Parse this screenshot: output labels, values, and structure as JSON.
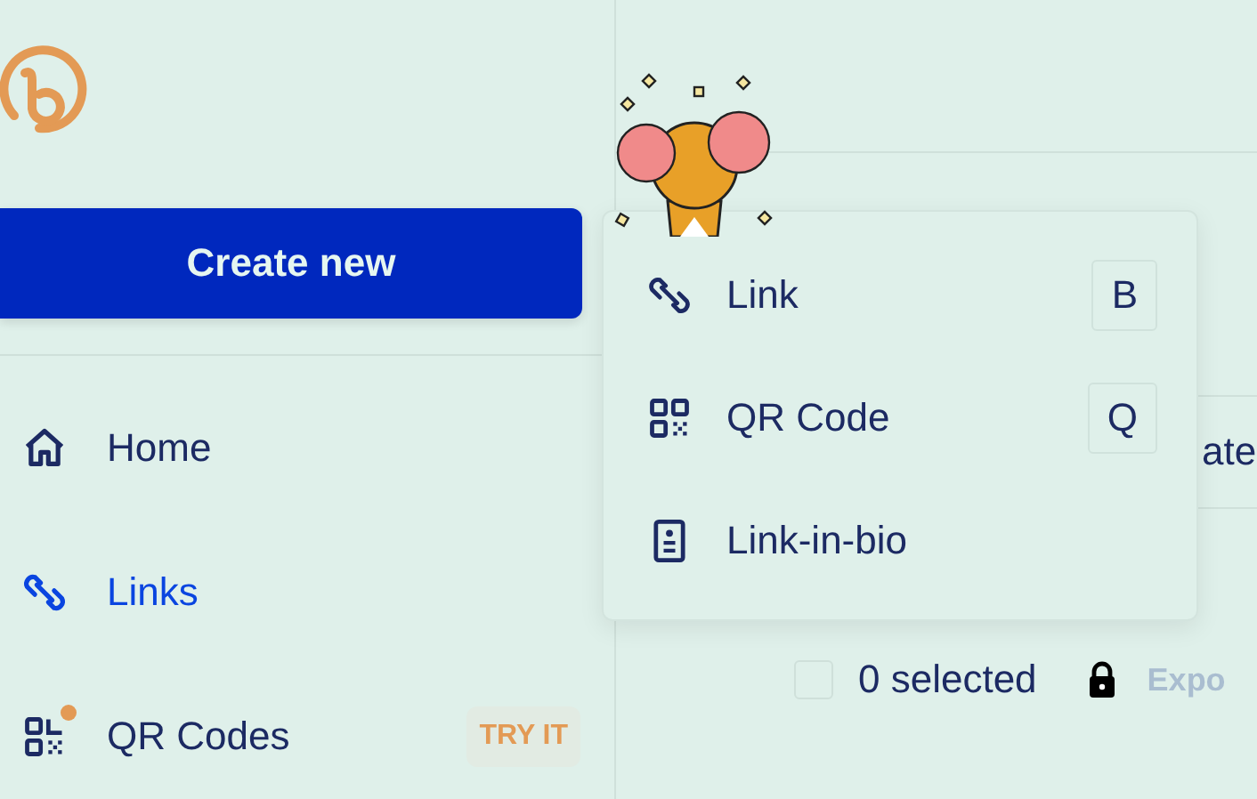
{
  "create_button": {
    "label": "Create new"
  },
  "nav": [
    {
      "label": "Home",
      "selected": false
    },
    {
      "label": "Links",
      "selected": true
    },
    {
      "label": "QR Codes",
      "selected": false,
      "new": true,
      "badge": "TRY IT"
    }
  ],
  "menu": {
    "items": [
      {
        "label": "Link",
        "shortcut": "B"
      },
      {
        "label": "QR Code",
        "shortcut": "Q"
      },
      {
        "label": "Link-in-bio"
      }
    ]
  },
  "main": {
    "field_text": "ate",
    "selection": {
      "checked": false,
      "label": "0 selected"
    },
    "export": {
      "label": "Expo",
      "locked": true
    }
  }
}
